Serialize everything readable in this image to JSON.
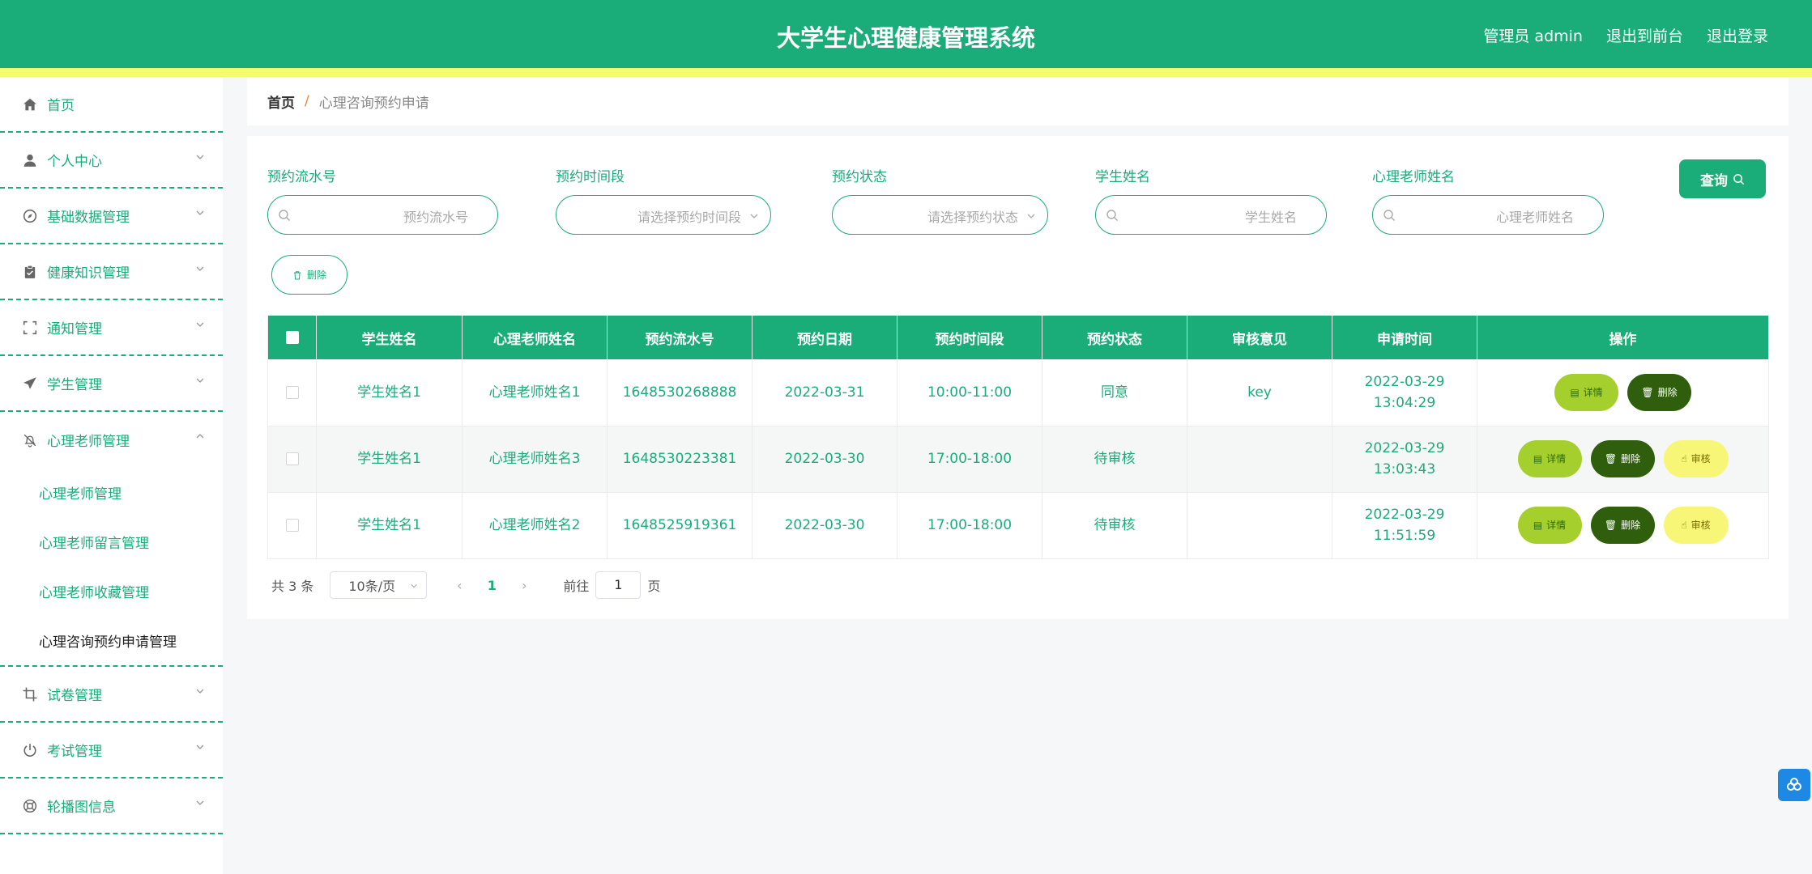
{
  "header": {
    "title": "大学生心理健康管理系统",
    "user": "管理员 admin",
    "front_link": "退出到前台",
    "logout": "退出登录"
  },
  "sidebar": {
    "items": [
      {
        "label": "首页",
        "icon": "home-icon"
      },
      {
        "label": "个人中心",
        "icon": "user-icon"
      },
      {
        "label": "基础数据管理",
        "icon": "compass-icon"
      },
      {
        "label": "健康知识管理",
        "icon": "clipboard-icon"
      },
      {
        "label": "通知管理",
        "icon": "frame-icon"
      },
      {
        "label": "学生管理",
        "icon": "send-icon"
      },
      {
        "label": "心理老师管理",
        "icon": "bell-off-icon"
      },
      {
        "label": "试卷管理",
        "icon": "crop-icon"
      },
      {
        "label": "考试管理",
        "icon": "power-icon"
      },
      {
        "label": "轮播图信息",
        "icon": "lifebuoy-icon"
      }
    ],
    "sub_items": [
      "心理老师管理",
      "心理老师留言管理",
      "心理老师收藏管理",
      "心理咨询预约申请管理"
    ]
  },
  "breadcrumb": {
    "home": "首页",
    "separator": "/",
    "current": "心理咨询预约申请"
  },
  "search": {
    "fields": [
      {
        "label": "预约流水号",
        "placeholder": "预约流水号"
      },
      {
        "label": "预约时间段",
        "placeholder": "请选择预约时间段"
      },
      {
        "label": "预约状态",
        "placeholder": "请选择预约状态"
      },
      {
        "label": "学生姓名",
        "placeholder": "学生姓名"
      },
      {
        "label": "心理老师姓名",
        "placeholder": "心理老师姓名"
      }
    ],
    "query_label": "查询"
  },
  "actions": {
    "delete_label": "删除"
  },
  "table": {
    "columns": [
      "学生姓名",
      "心理老师姓名",
      "预约流水号",
      "预约日期",
      "预约时间段",
      "预约状态",
      "审核意见",
      "申请时间",
      "操作"
    ],
    "rows": [
      {
        "student": "学生姓名1",
        "teacher": "心理老师姓名1",
        "serial": "1648530268888",
        "date": "2022-03-31",
        "slot": "10:00-11:00",
        "status": "同意",
        "opinion": "key",
        "applied": "2022-03-29 13:04:29"
      },
      {
        "student": "学生姓名1",
        "teacher": "心理老师姓名3",
        "serial": "1648530223381",
        "date": "2022-03-30",
        "slot": "17:00-18:00",
        "status": "待审核",
        "opinion": "",
        "applied": "2022-03-29 13:03:43"
      },
      {
        "student": "学生姓名1",
        "teacher": "心理老师姓名2",
        "serial": "1648525919361",
        "date": "2022-03-30",
        "slot": "17:00-18:00",
        "status": "待审核",
        "opinion": "",
        "applied": "2022-03-29 11:51:59"
      }
    ],
    "op_labels": {
      "detail": "详情",
      "delete": "删除",
      "audit": "审核"
    }
  },
  "pagination": {
    "total": "共 3 条",
    "page_size": "10条/页",
    "current_page": "1",
    "goto_label": "前往",
    "goto_value": "1",
    "page_suffix": "页"
  },
  "colors": {
    "primary": "#1aac79",
    "accent_line": "#f4fc6e",
    "detail_btn": "#a5cf2d",
    "delete_btn": "#2f5f0c",
    "audit_btn": "#f7f676"
  }
}
